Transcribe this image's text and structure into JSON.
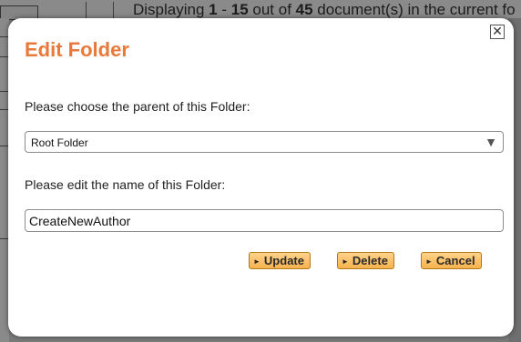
{
  "background": {
    "status_prefix": "Displaying ",
    "range_start": "1",
    "range_sep": " - ",
    "range_end": "15",
    "of_text": " out of ",
    "total": "45",
    "status_suffix": " document(s) in the current fo"
  },
  "dialog": {
    "title": "Edit Folder",
    "close_glyph": "✕",
    "parent_label": "Please choose the parent of this Folder:",
    "parent_select_value": "Root Folder",
    "name_label": "Please edit the name of this Folder:",
    "name_value": "CreateNewAuthor",
    "buttons": {
      "update": "Update",
      "delete": "Delete",
      "cancel": "Cancel"
    }
  },
  "colors": {
    "title": "#e8793a",
    "button_bg": "#f7b24e",
    "overlay": "#7a7a7a"
  }
}
